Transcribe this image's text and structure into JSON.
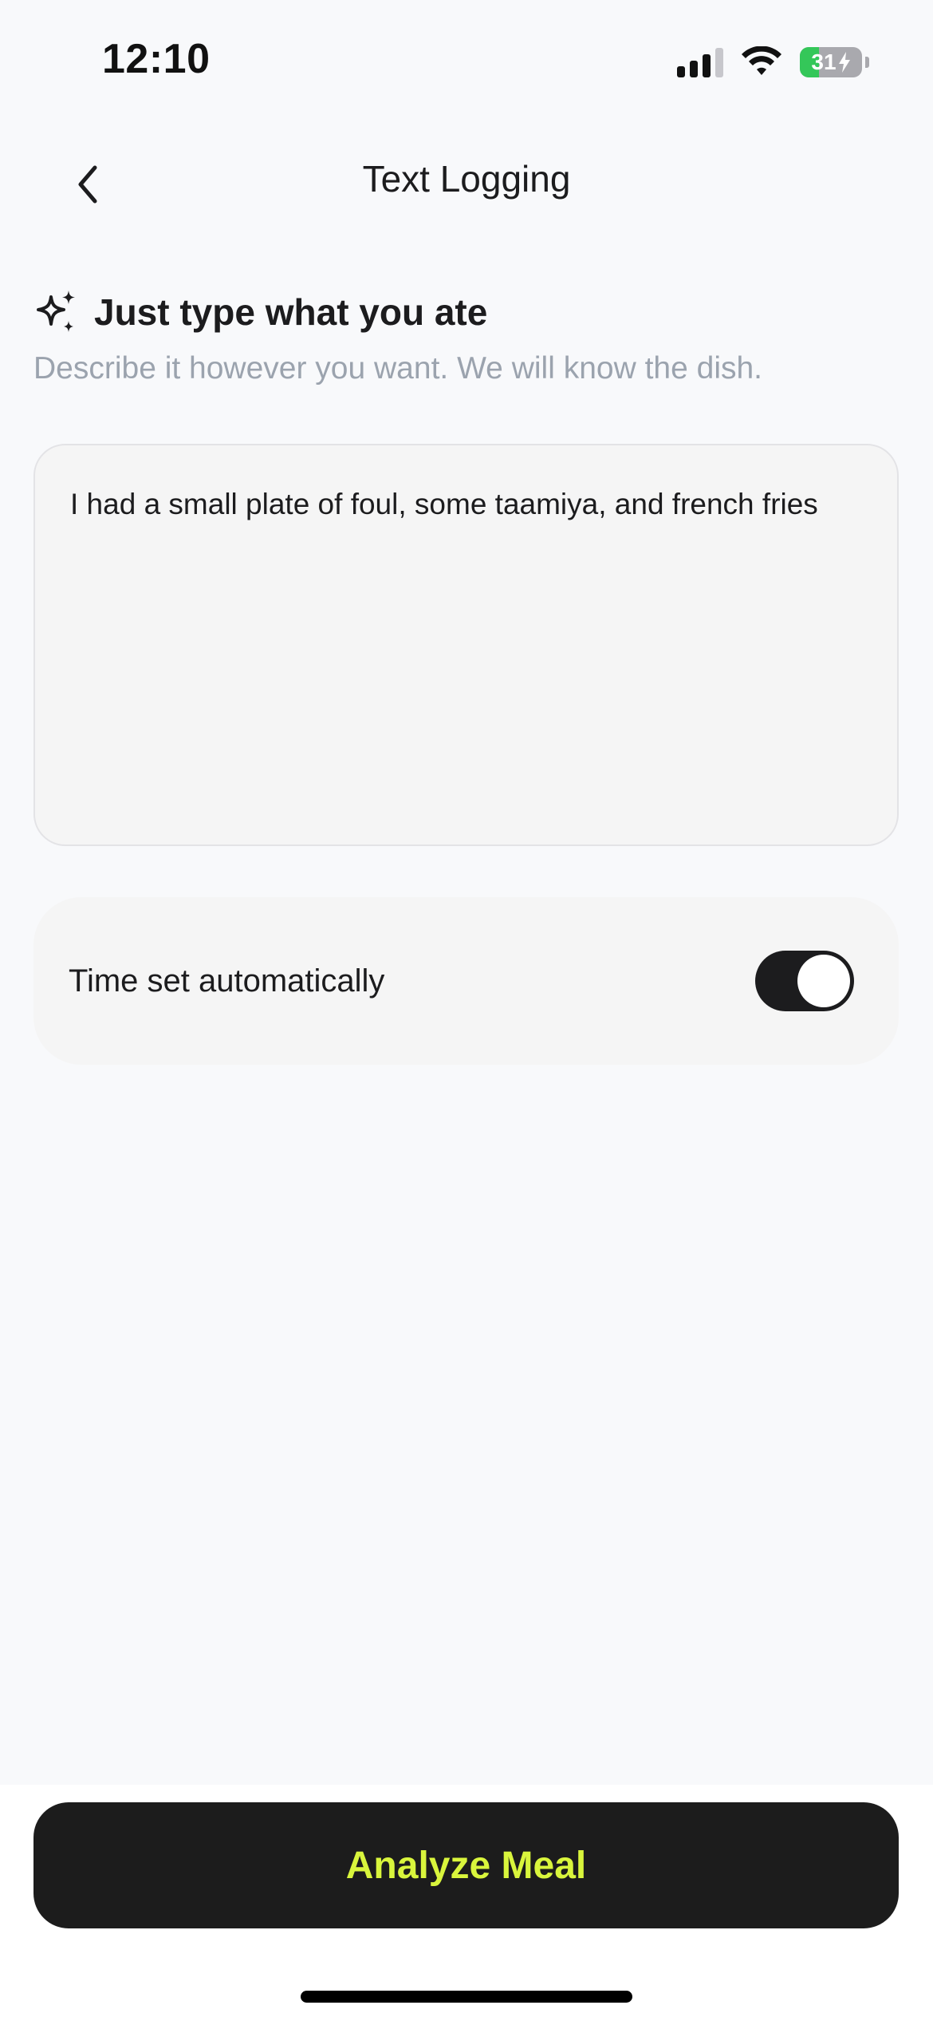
{
  "status_bar": {
    "time": "12:10",
    "battery_level": "31",
    "battery_fraction": 0.31,
    "charging": true
  },
  "nav": {
    "title": "Text Logging",
    "back_icon": "chevron-left-icon"
  },
  "intro": {
    "icon": "sparkles-icon",
    "heading": "Just type what you ate",
    "subtitle": "Describe it however you want. We will know the dish."
  },
  "meal_input": {
    "value": "I had a small plate of foul, some taamiya, and french fries"
  },
  "time_setting": {
    "label": "Time set automatically",
    "enabled": true
  },
  "actions": {
    "analyze_label": "Analyze Meal"
  },
  "colors": {
    "background": "#F8F9FB",
    "card": "#F5F5F5",
    "button_bg": "#1C1C1C",
    "button_text": "#D9F53C",
    "subtitle": "#9BA3AE",
    "toggle_on": "#1C1C1E"
  }
}
